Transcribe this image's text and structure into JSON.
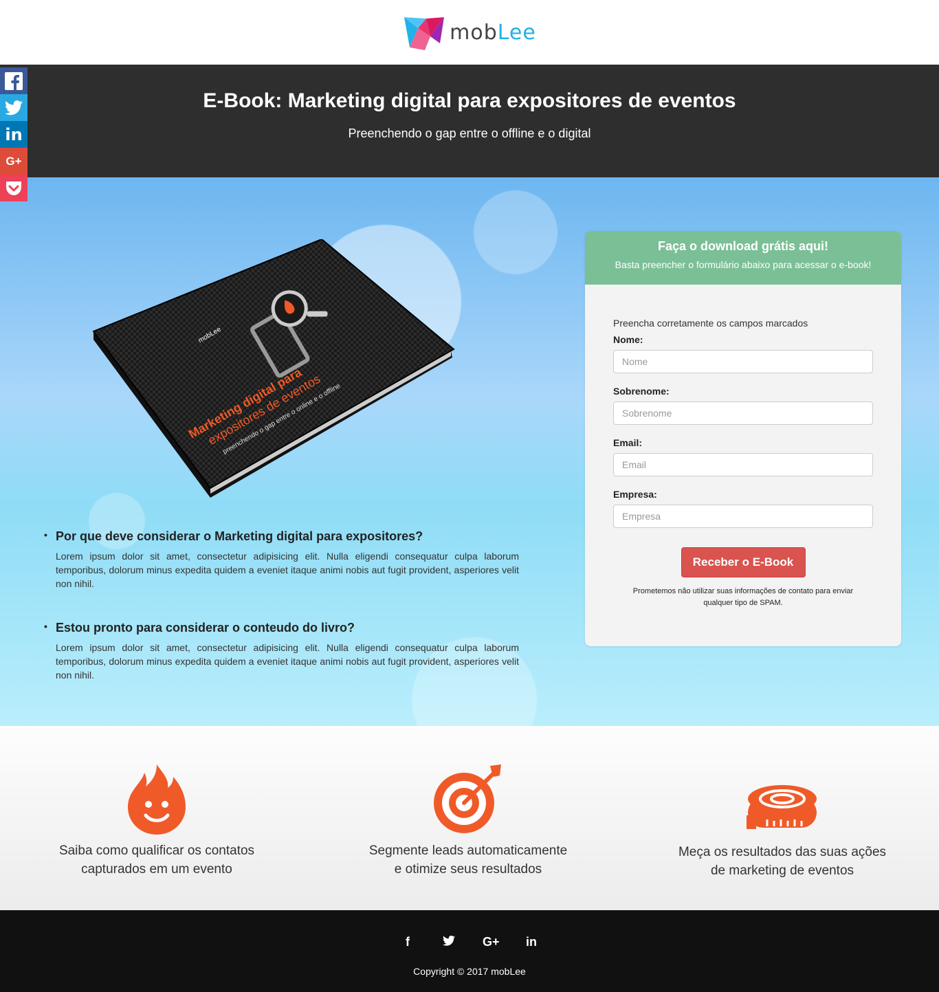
{
  "logo": {
    "part1": "mob",
    "part2": "Lee"
  },
  "header": {
    "title": "E-Book: Marketing digital para expositores de eventos",
    "subtitle": "Preenchendo o gap entre o offline e o digital"
  },
  "share": {
    "facebook": "f",
    "twitter": "t",
    "linkedin": "in",
    "googleplus": "G+",
    "pocket": "p"
  },
  "book": {
    "brand": "mobLee",
    "title_line1": "Marketing digital para",
    "title_line2": "expositores de eventos",
    "tagline": "preenchendo o gap entre o online e o offline"
  },
  "points": [
    {
      "title": "Por que deve considerar o Marketing digital para expositores?",
      "text": "Lorem ipsum dolor sit amet, consectetur adipisicing elit. Nulla eligendi consequatur culpa laborum temporibus, dolorum minus expedita quidem a eveniet itaque animi nobis aut fugit provident, asperiores velit non nihil."
    },
    {
      "title": "Estou pronto para considerar o conteudo do livro?",
      "text": "Lorem ipsum dolor sit amet, consectetur adipisicing elit. Nulla eligendi consequatur culpa laborum temporibus, dolorum minus expedita quidem a eveniet itaque animi nobis aut fugit provident, asperiores velit non nihil."
    }
  ],
  "form": {
    "heading": "Faça o download grátis aqui!",
    "subheading": "Basta preencher o formulário abaixo para acessar o e-book!",
    "note": "Preencha corretamente os campos marcados",
    "fields": [
      {
        "label": "Nome:",
        "placeholder": "Nome"
      },
      {
        "label": "Sobrenome:",
        "placeholder": "Sobrenome"
      },
      {
        "label": "Email:",
        "placeholder": "Email"
      },
      {
        "label": "Empresa:",
        "placeholder": "Empresa"
      }
    ],
    "submit": "Receber o E-Book",
    "spam_note": "Prometemos não utilizar suas informações de contato para enviar qualquer tipo de SPAM."
  },
  "features": [
    {
      "icon": "flame-icon",
      "line1": "Saiba como qualificar os contatos",
      "line2": "capturados em um evento"
    },
    {
      "icon": "target-icon",
      "line1": "Segmente leads automaticamente",
      "line2": "e otimize seus resultados"
    },
    {
      "icon": "tape-measure-icon",
      "line1": "Meça os resultados das suas ações",
      "line2": "de marketing de eventos"
    }
  ],
  "footer": {
    "facebook": "f",
    "twitter": "t",
    "googleplus": "G+",
    "linkedin": "in",
    "copyright": "Copyright © 2017 mobLee"
  },
  "colors": {
    "accent": "#f05a28",
    "form_header": "#7bbf96",
    "submit": "#d9534f",
    "dark": "#2e2e2e"
  }
}
